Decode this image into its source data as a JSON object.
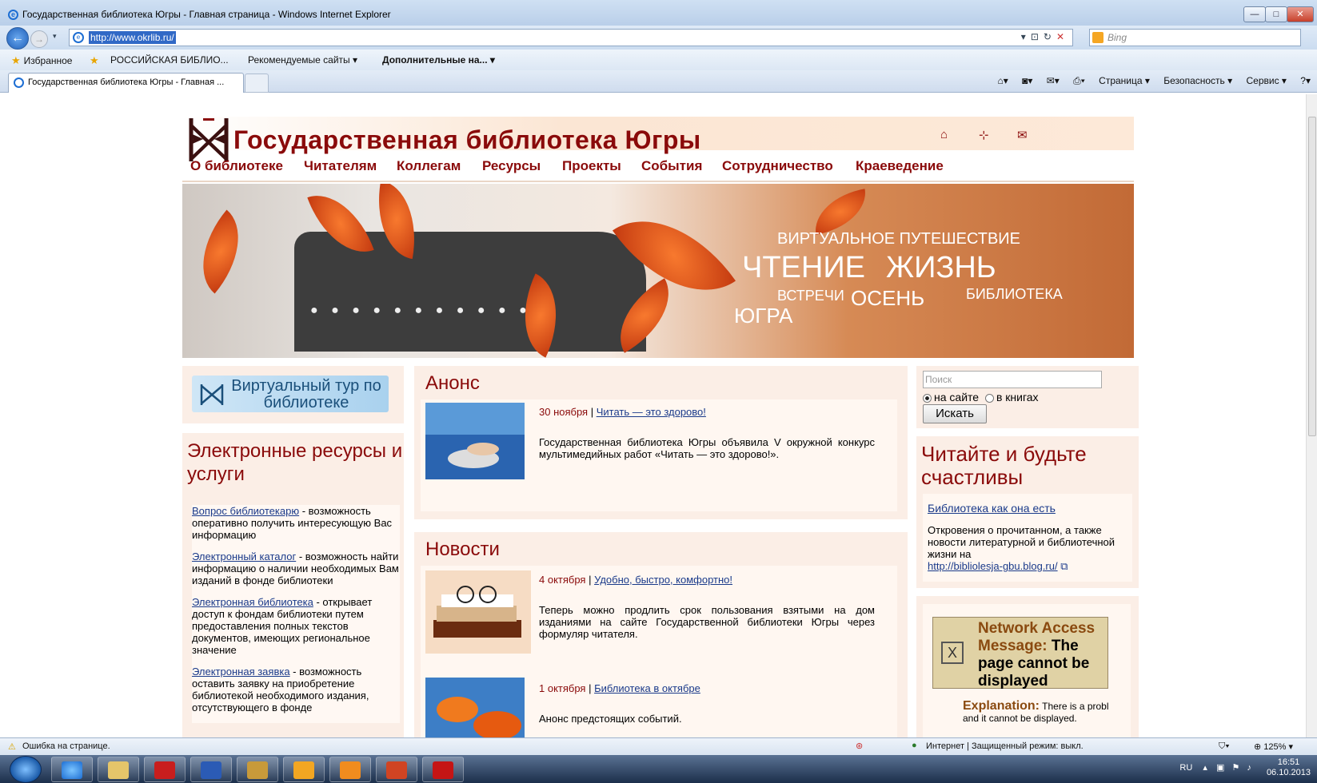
{
  "window": {
    "title": "Государственная библиотека Югры - Главная страница - Windows Internet Explorer",
    "min": "—",
    "max": "□",
    "close": "✕"
  },
  "address": {
    "url": "http://www.okrlib.ru/",
    "search_placeholder": "Bing"
  },
  "favorites": {
    "label": "Избранное",
    "items": [
      "РОССИЙСКАЯ БИБЛИО...",
      "Рекомендуемые сайты ▾",
      "Дополнительные на... ▾"
    ]
  },
  "tab": {
    "label": "Государственная библиотека Югры - Главная ..."
  },
  "commandbar": {
    "page": "Страница ▾",
    "security": "Безопасность ▾",
    "service": "Сервис ▾"
  },
  "site": {
    "title": "Государственная библиотека Югры",
    "menu": [
      "О библиотеке",
      "Читателям",
      "Коллегам",
      "Ресурсы",
      "Проекты",
      "События",
      "Сотрудничество",
      "Краеведение"
    ],
    "banner_words": [
      "ВИРТУАЛЬНОЕ ПУТЕШЕСТВИЕ",
      "ЧТЕНИЕ",
      "ЖИЗНЬ",
      "ВСТРЕЧИ",
      "ОСЕНЬ",
      "БИБЛИОТЕКА",
      "ЮГРА"
    ]
  },
  "left": {
    "tour": "Виртуальный тур по библиотеке",
    "resources_title": "Электронные ресурсы и услуги",
    "items": [
      {
        "link": "Вопрос библиотекарю",
        "text": " - возможность оперативно получить интересующую Вас информацию"
      },
      {
        "link": "Электронный каталог",
        "text": " - возможность найти информацию о наличии необходимых Вам изданий в фонде библиотеки"
      },
      {
        "link": "Электронная библиотека",
        "text": " - открывает доступ к фондам библиотеки путем предоставления полных текстов документов, имеющих региональное значение"
      },
      {
        "link": "Электронная заявка",
        "text": " - возможность оставить заявку на приобретение библиотекой необходимого издания, отсутствующего в фонде"
      }
    ]
  },
  "anons": {
    "title": "Анонс",
    "date": "30 ноября",
    "sep": " | ",
    "link": "Читать — это здорово!",
    "text": "Государственная библиотека Югры объявила V окружной конкурс мультимедийных работ «Читать — это здорово!»."
  },
  "news": {
    "title": "Новости",
    "items": [
      {
        "date": "4 октября",
        "link": "Удобно, быстро, комфортно!",
        "text": "Теперь можно продлить срок пользования взятыми на дом изданиями на сайте Государственной библиотеки Югры через формуляр читателя."
      },
      {
        "date": "1 октября",
        "link": "Библиотека в октябре",
        "text": "Анонс предстоящих событий."
      }
    ]
  },
  "right": {
    "search_placeholder": "Поиск",
    "radio_site": "на сайте",
    "radio_books": "в книгах",
    "search_button": "Искать",
    "happy_title": "Читайте и будьте счастливы",
    "happy_link": "Библиотека как она есть",
    "happy_text": "Откровения о прочитанном, а также новости литературной и библиотечной жизни на",
    "happy_url": "http://bibliolesja-gbu.blog.ru/",
    "net_title": "Network Access Message:",
    "net_title2": "The page cannot be displayed",
    "net_expl_label": "Explanation:",
    "net_expl": "There is a probl",
    "net_expl2": "and it cannot be displayed."
  },
  "status": {
    "error": "Ошибка на странице.",
    "zone": "Интернет | Защищенный режим: выкл.",
    "zoom": "125%"
  },
  "tray": {
    "lang": "RU",
    "time": "16:51",
    "date": "06.10.2013"
  }
}
